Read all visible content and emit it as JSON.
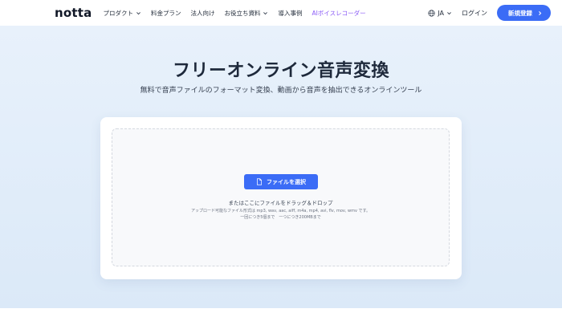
{
  "header": {
    "logo": "notta",
    "nav": [
      {
        "label": "プロダクト",
        "dropdown": true
      },
      {
        "label": "料金プラン",
        "dropdown": false
      },
      {
        "label": "法人向け",
        "dropdown": false
      },
      {
        "label": "お役立ち資料",
        "dropdown": true
      },
      {
        "label": "導入事例",
        "dropdown": false
      },
      {
        "label": "AIボイスレコーダー",
        "dropdown": false
      }
    ],
    "language": "JA",
    "login": "ログイン",
    "signup": "新規登録"
  },
  "hero": {
    "title": "フリーオンライン音声変換",
    "subtitle": "無料で音声ファイルのフォーマット変換、動画から音声を抽出できるオンラインツール"
  },
  "upload": {
    "button_label": "ファイルを選択",
    "drop_text": "またはここにファイルをドラッグ＆ドロップ",
    "formats": "アップロード可能なファイル形式は mp3, wav, aac, aiff, m4a, mp4, avi, flv, mov, wmv です。",
    "limits": "一回につき5個まで　一つにつき200MBまで"
  },
  "colors": {
    "accent": "#3b6cf6",
    "ai_link": "#8b5cf6",
    "hero_bg": "#e3eefa"
  }
}
